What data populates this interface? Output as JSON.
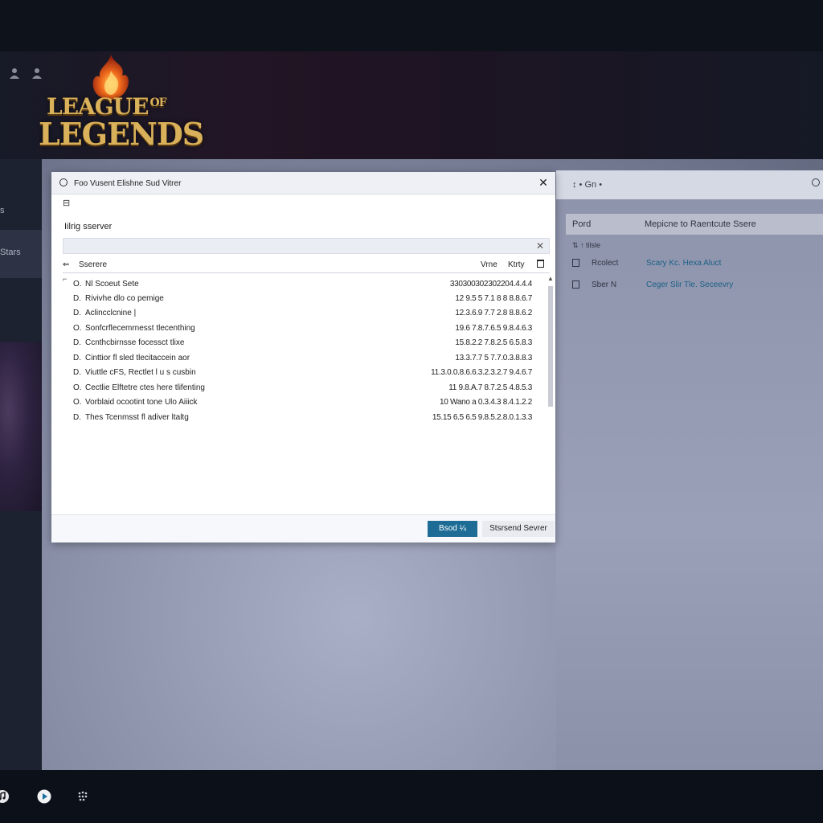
{
  "header": {
    "logo": {
      "line1": "LEAGUE",
      "line1_of": "OF",
      "line2": "LEGENDS"
    },
    "icons": [
      "user-icon",
      "user-icon"
    ]
  },
  "sidebar": {
    "items": [
      {
        "label": "s"
      },
      {
        "label": "Stars"
      }
    ]
  },
  "dialog": {
    "title": "Foo Vusent Elishne Sud Vitrer",
    "toolbar_icon": "⊟",
    "heading": "Iilrig sserver",
    "search": {
      "value": "",
      "placeholder": ""
    },
    "columns": {
      "server": "Sserere",
      "view": "Vrne",
      "key": "Ktrty"
    },
    "rows": [
      {
        "idx": "O.",
        "name": "Nl Scoeut Sete",
        "value": "330300302302204.4.4.4"
      },
      {
        "idx": "D.",
        "name": "Rivivhe dlo co pemige",
        "value": "12 9.5 5 7.1 8 8 8.8.6.7"
      },
      {
        "idx": "D.",
        "name": "Aclincclcnine |",
        "value": "12.3.6.9 7.7 2.8 8.8.6.2"
      },
      {
        "idx": "O.",
        "name": "Sonfcrflecemrnesst tlecenthing",
        "value": "19.6 7.8.7.6.5 9.8.4.6.3"
      },
      {
        "idx": "D.",
        "name": "Ccnthcbirnsse focessct tlixe",
        "value": "15.8.2.2 7.8.2.5 6.5.8.3"
      },
      {
        "idx": "D.",
        "name": "Cinttior fl sled tlecitaccein aor",
        "value": "13.3.7.7 5 7.7.0.3.8.8.3"
      },
      {
        "idx": "D.",
        "name": "Viuttle cFS, Rectlet l u s cusbin",
        "value": "11.3.0.0.8.6.6.3.2.3.2.7 9.4.6.7"
      },
      {
        "idx": "O.",
        "name": "Cectlie Elftetre ctes here tlifenting",
        "value": "11 9.8.A.7 8.7.2.5 4.8.5.3"
      },
      {
        "idx": "O.",
        "name": "Vorblaid ocootint tone Ulo Aiiick",
        "value": "10 Wano a 0.3.4.3 8.4.1.2.2"
      },
      {
        "idx": "D.",
        "name": "Thes Tcenmsst fl adiver ltaltg",
        "value": "15.15 6.5 6.5 9.8.5.2.8.0.1.3.3"
      }
    ],
    "buttons": {
      "primary": "Bsod ¼",
      "secondary": "Stsrsend Sevrer"
    }
  },
  "right_panel": {
    "sort": "↕ • Gn •",
    "columns": {
      "left": "Pord",
      "right": "Mepicne to Raentcute Ssere"
    },
    "subheader": "⇅ ↑ tilsle",
    "rows": [
      {
        "name": "Rcolect",
        "status": "Scary Kc. Hexa Aluct"
      },
      {
        "name": "Sber N",
        "status": "Ceger Slir Tle. Seceevry"
      }
    ]
  },
  "taskbar": {
    "icons": [
      "music-icon",
      "play-icon",
      "settings-icon"
    ]
  },
  "colors": {
    "accent_button": "#1c6c95",
    "link": "#1b5f86",
    "logo_gold": "#d9b15a"
  }
}
